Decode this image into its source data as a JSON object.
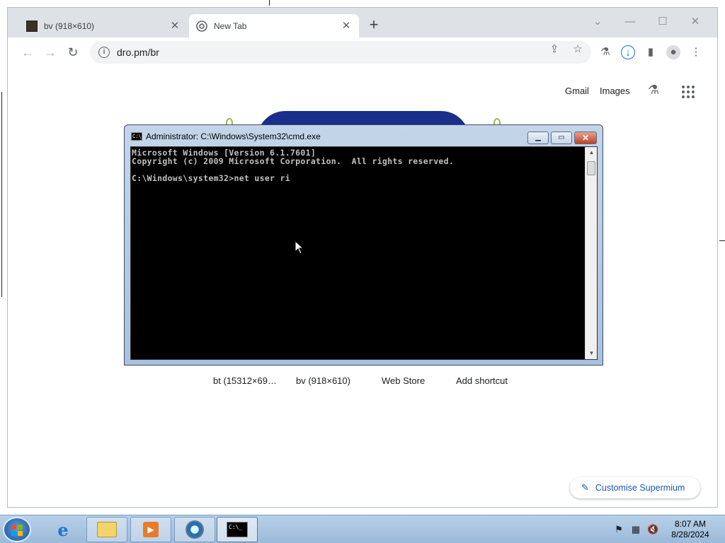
{
  "browser": {
    "tabs": [
      {
        "title": "bv (918×610)",
        "active": false,
        "favicon": "image-thumbnail-icon"
      },
      {
        "title": "New Tab",
        "active": true,
        "favicon": "chromium-icon"
      }
    ],
    "address": "dro.pm/br",
    "top_links": {
      "gmail": "Gmail",
      "images": "Images"
    },
    "shortcuts": [
      "bt (15312×69…",
      "bv (918×610)",
      "Web Store",
      "Add shortcut"
    ],
    "customise_label": "Customise Supermium"
  },
  "cmd": {
    "title": "Administrator: C:\\Windows\\System32\\cmd.exe",
    "lines": [
      "Microsoft Windows [Version 6.1.7601]",
      "Copyright (c) 2009 Microsoft Corporation.  All rights reserved.",
      "",
      "C:\\Windows\\system32>net user ri"
    ]
  },
  "taskbar": {
    "time": "8:07 AM",
    "date": "8/28/2024",
    "apps": [
      "internet-explorer",
      "file-explorer",
      "media-player",
      "browser",
      "command-prompt"
    ]
  }
}
